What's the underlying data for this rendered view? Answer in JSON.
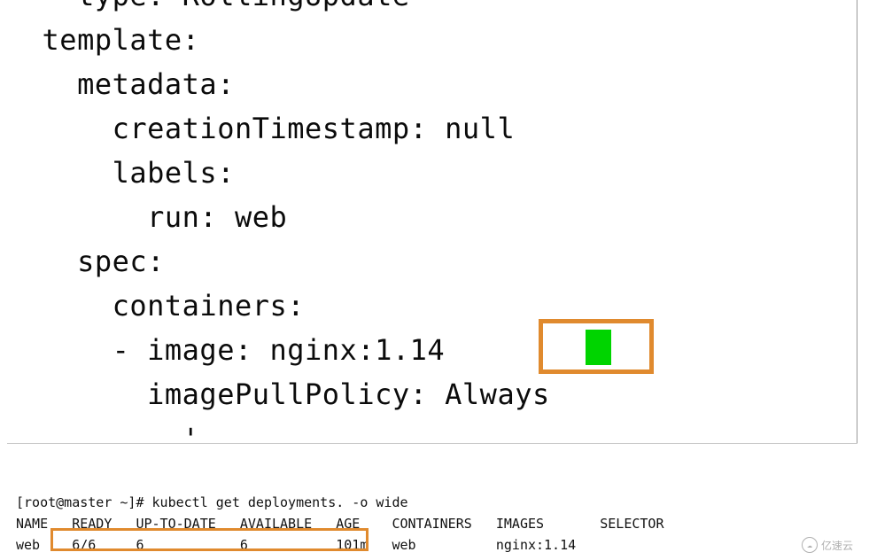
{
  "yaml": {
    "line1": "    type: RollingUpdate",
    "line2": "  template:",
    "line3": "    metadata:",
    "line4": "      creationTimestamp: null",
    "line5": "      labels:",
    "line6": "        run: web",
    "line7": "    spec:",
    "line8": "      containers:",
    "line9": "      - image: nginx:1.14",
    "line10": "        imagePullPolicy: Always",
    "line11": "          '"
  },
  "highlighted_image_version": "14",
  "terminal": {
    "prompt": "[root@master ~]# ",
    "command": "kubectl get deployments. -o wide",
    "headers": "NAME   READY   UP-TO-DATE   AVAILABLE   AGE    CONTAINERS   IMAGES       SELECTOR",
    "row": "web    6/6     6            6           101m   web          nginx:1.14"
  },
  "deployment_highlight": {
    "name": "web",
    "ready": "6/6",
    "up_to_date": "6",
    "available": "6"
  },
  "watermark": {
    "text": "亿速云"
  }
}
